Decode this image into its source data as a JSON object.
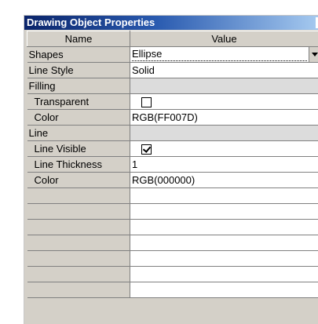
{
  "window": {
    "title": "Drawing Object Properties"
  },
  "grid": {
    "headers": {
      "name": "Name",
      "value": "Value"
    },
    "rows": [
      {
        "name": "Shapes",
        "value": "Ellipse",
        "kind": "dropdown"
      },
      {
        "name": "Line Style",
        "value": "Solid",
        "kind": "text"
      },
      {
        "name": "Filling",
        "value": "",
        "kind": "group"
      },
      {
        "name": "Transparent",
        "value": "",
        "kind": "checkbox",
        "checked": false
      },
      {
        "name": "Color",
        "value": "RGB(FF007D)",
        "kind": "text"
      },
      {
        "name": "Line",
        "value": "",
        "kind": "group"
      },
      {
        "name": "Line Visible",
        "value": "",
        "kind": "checkbox",
        "checked": true
      },
      {
        "name": "Line Thickness",
        "value": "1",
        "kind": "text"
      },
      {
        "name": "Color",
        "value": "RGB(000000)",
        "kind": "text"
      }
    ]
  },
  "icons": {
    "dropdown": "chevron-down-icon",
    "checkmark": "checkmark-icon"
  },
  "colors": {
    "title_bar_start": "#0a246a",
    "title_bar_end": "#a6caf0",
    "group_row": "#dcdcdc",
    "window_bg": "#d4d0c8"
  }
}
